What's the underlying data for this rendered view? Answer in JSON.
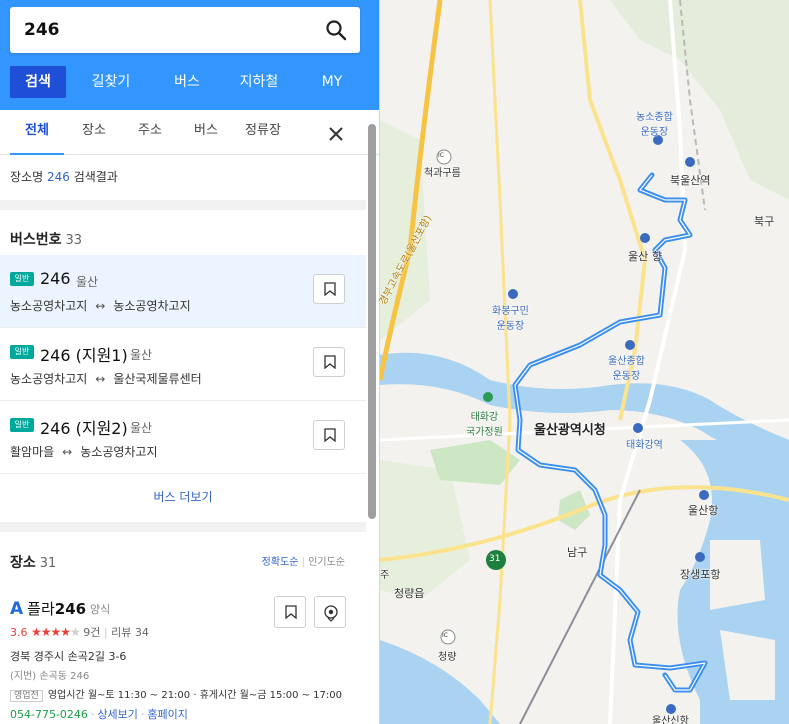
{
  "search": {
    "query": "246"
  },
  "menu": [
    {
      "label": "검색",
      "active": true
    },
    {
      "label": "길찾기"
    },
    {
      "label": "버스"
    },
    {
      "label": "지하철"
    },
    {
      "label": "MY"
    }
  ],
  "tabs": [
    {
      "label": "전체",
      "active": true
    },
    {
      "label": "장소"
    },
    {
      "label": "주소"
    },
    {
      "label": "버스"
    },
    {
      "label": "정류장"
    }
  ],
  "result_info": {
    "prefix": "장소명",
    "query": "246",
    "suffix": "검색결과"
  },
  "bus_section": {
    "title": "버스번호",
    "count": "33"
  },
  "buses": [
    {
      "badge": "일반",
      "number": "246",
      "region": "울산",
      "from": "농소공영차고지",
      "to": "농소공영차고지"
    },
    {
      "badge": "일반",
      "number": "246 (지원1)",
      "region": "울산",
      "from": "농소공영차고지",
      "to": "울산국제물류센터"
    },
    {
      "badge": "일반",
      "number": "246 (지원2)",
      "region": "울산",
      "from": "활암마을",
      "to": "농소공영차고지"
    }
  ],
  "more_bus": "버스 더보기",
  "place_section": {
    "title": "장소",
    "count": "31",
    "sort_accuracy": "정확도순",
    "sort_popular": "인기도순"
  },
  "place": {
    "marker": "A",
    "name_main": "플라",
    "name_bold": "246",
    "category": "양식",
    "score": "3.6",
    "review_count": "9건",
    "review_label": "리뷰 34",
    "address": "경북 경주시 손곡2길 3-6",
    "jibun": "(지번) 손곡동 246",
    "status": "영업전",
    "hours": "영업시간 월~토 11:30 ~ 21:00 · 휴게시간 월~금 15:00 ~ 17:00",
    "phone": "054-775-0246",
    "detail_link": "상세보기",
    "homepage_link": "홈페이지"
  },
  "map": {
    "labels": {
      "nongso_stadium": "농소종합\n운동장",
      "buk_ulsan_station": "북울산역",
      "bukgu": "북구",
      "ulsan_stop": "울산",
      "hyang": "향",
      "jiwangu": "척과구름",
      "hwabong": "화봉구민\n운동장",
      "ulsan_stadium": "울산종합\n운동장",
      "taehwagang_park": "태화강\n국가정원",
      "city_hall": "울산광역시청",
      "taehwagang_station": "태화강역",
      "ulsan_port": "울산항",
      "namgu": "남구",
      "jangsaengpo": "장생포항",
      "cheongryang_eup": "청량읍",
      "cheongryang_ic": "청량",
      "ulsan_si_hang": "울산신항",
      "road_31": "31",
      "ju": "주",
      "expressway": "경부고속도로(울산포항)",
      "ic": "IC"
    },
    "colors": {
      "route": "#3a8ef0",
      "water": "#aad3f1",
      "land": "#f3f2ee",
      "green": "#cde6c4"
    }
  }
}
